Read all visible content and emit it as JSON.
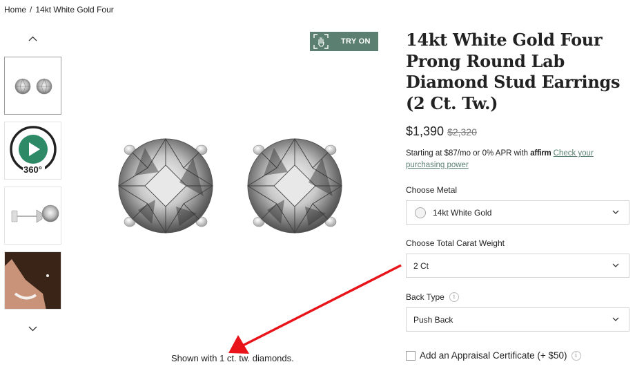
{
  "breadcrumb": {
    "home": "Home",
    "separator": "/",
    "current": "14kt White Gold Four"
  },
  "gallery": {
    "up_icon": "chevron-up-icon",
    "down_icon": "chevron-down-icon",
    "thumb_360_label": "360°"
  },
  "try_on": {
    "label": "TRY ON",
    "icon": "hand-scan-icon",
    "bg_color": "#5b8071"
  },
  "main_image": {
    "caption": "Shown with 1 ct. tw. diamonds."
  },
  "product": {
    "title": "14kt White Gold Four Prong Round Lab Diamond Stud Earrings (2 Ct. Tw.)",
    "price": "$1,390",
    "original_price": "$2,320",
    "financing_text": "Starting at $87/mo or 0% APR with",
    "financing_brand": "affirm",
    "financing_link": "Check your purchasing power"
  },
  "options": {
    "metal_label": "Choose Metal",
    "metal_value": "14kt White Gold",
    "carat_label": "Choose Total Carat Weight",
    "carat_value": "2 Ct",
    "back_label": "Back Type",
    "back_value": "Push Back"
  },
  "appraisal": {
    "label": "Add an Appraisal Certificate (+ $50)"
  },
  "colors": {
    "accent": "#5b8071",
    "annotation_arrow": "#e8141a"
  }
}
